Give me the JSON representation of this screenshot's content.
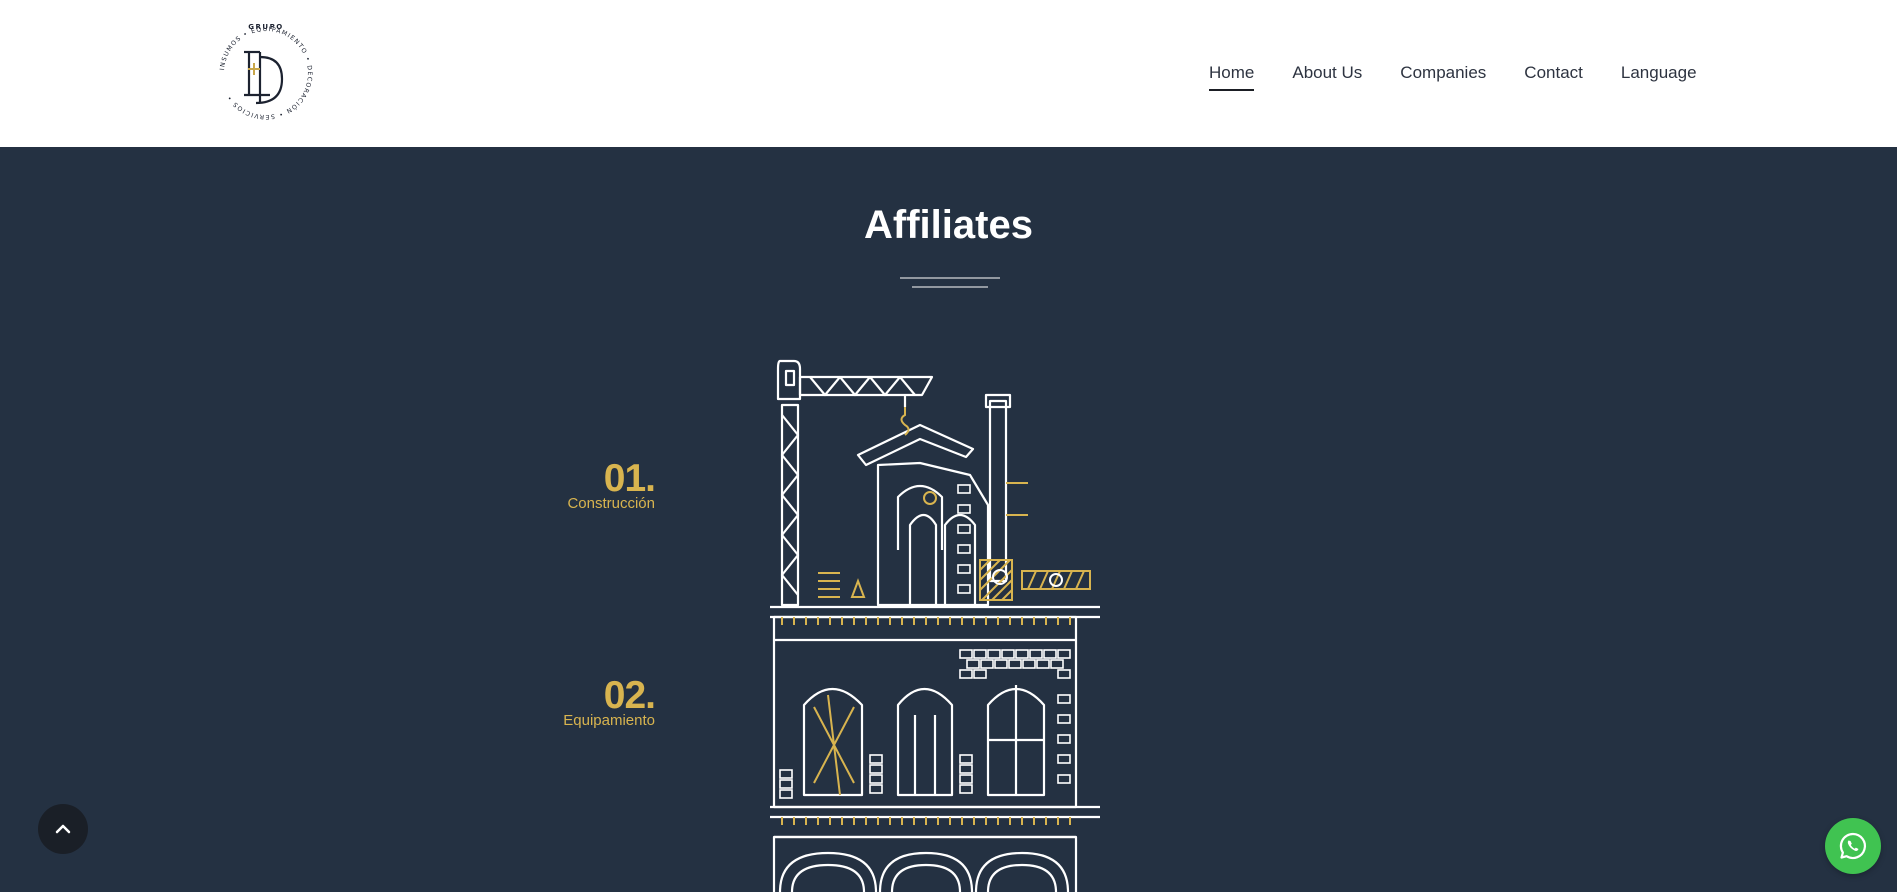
{
  "nav": {
    "items": [
      {
        "label": "Home",
        "active": true
      },
      {
        "label": "About Us",
        "active": false
      },
      {
        "label": "Companies",
        "active": false
      },
      {
        "label": "Contact",
        "active": false
      },
      {
        "label": "Language",
        "active": false
      }
    ]
  },
  "logo": {
    "ring_top": "GRUPO",
    "ring_text": "INSUMOS • EQUIPAMIENTO • DECORACIÓN • SERVICIOS •",
    "monogram": "E+D"
  },
  "section": {
    "title": "Affiliates"
  },
  "affiliates": [
    {
      "number": "01.",
      "name": "Construcción"
    },
    {
      "number": "02.",
      "name": "Equipamiento"
    }
  ],
  "icons": {
    "scroll_top": "chevron-up-icon",
    "whatsapp": "whatsapp-icon"
  },
  "colors": {
    "background": "#243142",
    "header": "#ffffff",
    "accent_gold": "#d8b44f",
    "whatsapp_green": "#40c351"
  }
}
